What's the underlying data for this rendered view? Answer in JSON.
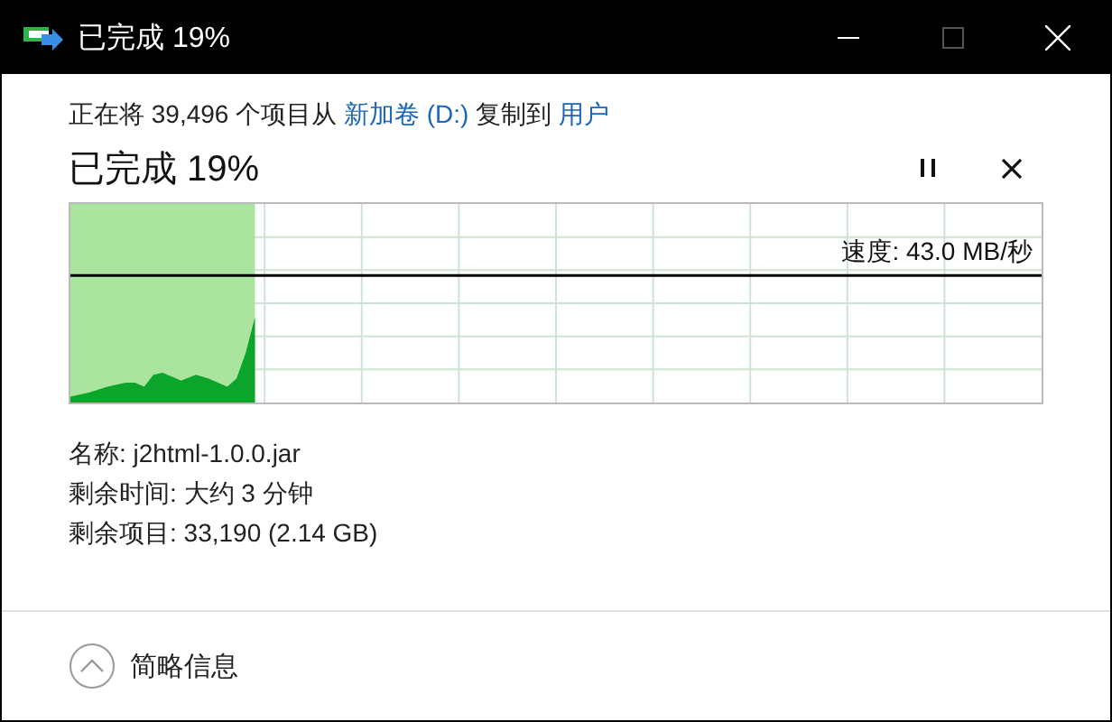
{
  "window": {
    "title": "已完成 19%"
  },
  "summary": [
    {
      "kind": "text",
      "text": "正在将 39,496 个项目从 "
    },
    {
      "kind": "link",
      "text": "新加卷 (D:)"
    },
    {
      "kind": "text",
      "text": " 复制到 "
    },
    {
      "kind": "link",
      "text": "用户"
    }
  ],
  "progress": {
    "title": "已完成 19%",
    "level": 0.19,
    "speed": "速度: 43.0 MB/秒"
  },
  "details": [
    "名称: j2html-1.0.0.jar",
    "剩余时间: 大约 3 分钟",
    "剩余项目: 33,190 (2.14 GB)"
  ],
  "footer": {
    "toggle": "简略信息"
  }
}
